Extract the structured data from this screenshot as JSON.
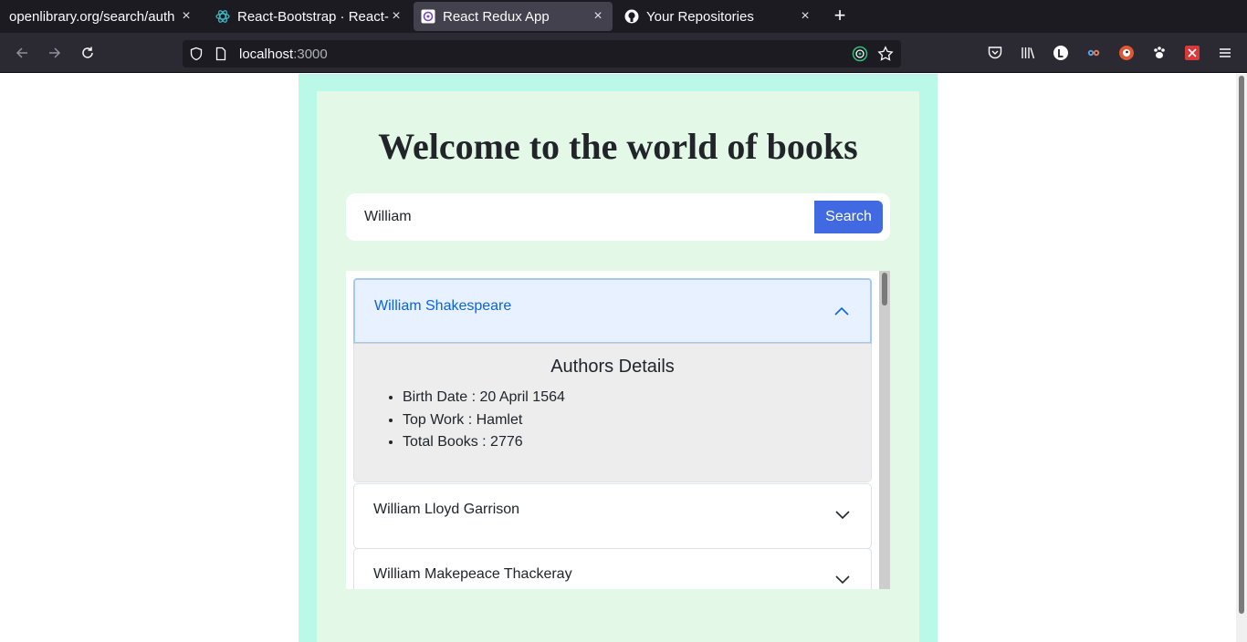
{
  "browser": {
    "tabs": [
      {
        "title": "openlibrary.org/search/auth",
        "icon": "openlibrary-icon",
        "active": false
      },
      {
        "title": "React-Bootstrap · React-B",
        "icon": "react-bootstrap-icon",
        "active": false
      },
      {
        "title": "React Redux App",
        "icon": "redux-icon",
        "active": true
      },
      {
        "title": "Your Repositories",
        "icon": "github-icon",
        "active": false
      }
    ],
    "new_tab_label": "+",
    "close_label": "×",
    "url_host": "localhost",
    "url_port": ":3000"
  },
  "page": {
    "title": "Welcome to the world of books",
    "search": {
      "value": "William",
      "button_label": "Search"
    },
    "results": [
      {
        "name": "William Shakespeare",
        "expanded": true,
        "details_title": "Authors Details",
        "details": [
          "Birth Date : 20 April 1564",
          "Top Work : Hamlet",
          "Total Books : 2776"
        ]
      },
      {
        "name": "William Lloyd Garrison",
        "expanded": false
      },
      {
        "name": "William Makepeace Thackeray",
        "expanded": false
      }
    ]
  },
  "colors": {
    "outer_bg": "#baf8e7",
    "inner_bg": "#e4f8e8",
    "search_button": "#4169e1",
    "active_accordion": "#e7f1ff",
    "accordion_link": "#0c63e4"
  }
}
